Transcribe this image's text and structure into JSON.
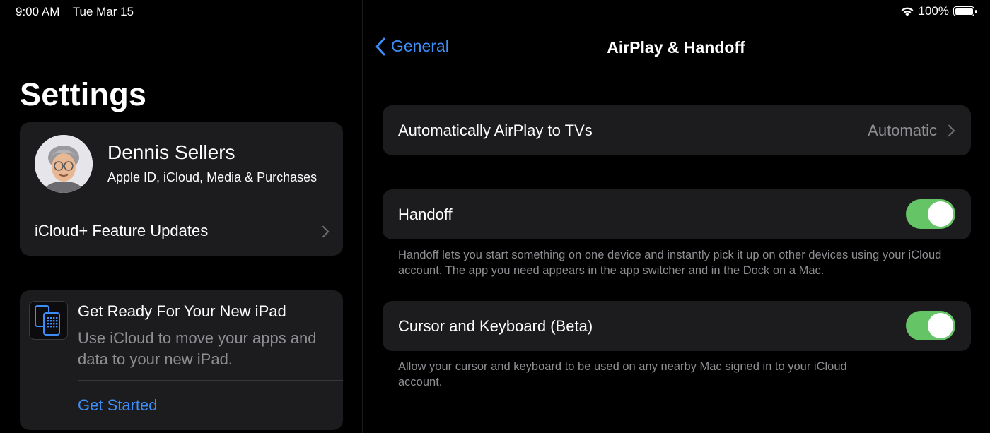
{
  "status_bar": {
    "time": "9:00 AM",
    "date": "Tue Mar 15",
    "battery": "100%",
    "battery_level": 1.0,
    "wifi_icon": "wifi-icon",
    "battery_icon": "battery-icon"
  },
  "sidebar": {
    "title": "Settings",
    "profile": {
      "name": "Dennis Sellers",
      "subtitle": "Apple ID, iCloud, Media & Purchases",
      "avatar": "memoji-avatar"
    },
    "icloud_row": "iCloud+ Feature Updates",
    "promo": {
      "title": "Get Ready For Your New iPad",
      "description": "Use iCloud to move your apps and data to your new iPad.",
      "action": "Get Started",
      "icon": "ipad-transfer-icon"
    }
  },
  "detail": {
    "back_label": "General",
    "title": "AirPlay & Handoff",
    "rows": {
      "airplay": {
        "label": "Automatically AirPlay to TVs",
        "value": "Automatic"
      },
      "handoff": {
        "label": "Handoff",
        "on": true
      },
      "handoff_footer": "Handoff lets you start something on one device and instantly pick it up on other devices using your iCloud account. The app you need appears in the app switcher and in the Dock on a Mac.",
      "cursor": {
        "label": "Cursor and Keyboard (Beta)",
        "on": true
      },
      "cursor_footer": "Allow your cursor and keyboard to be used on any nearby Mac signed in to your iCloud account."
    }
  },
  "colors": {
    "accent": "#3d8ef7",
    "toggle_on": "#65c466",
    "card": "#1c1c1e",
    "secondary_text": "#8e8e93"
  }
}
